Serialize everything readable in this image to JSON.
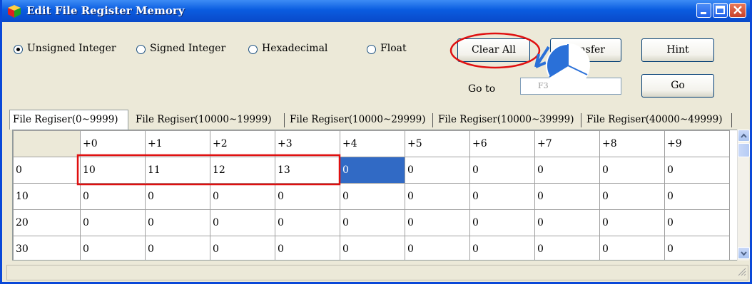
{
  "window": {
    "title": "Edit File Register Memory"
  },
  "format_options": [
    {
      "label": "Unsigned Integer",
      "selected": true
    },
    {
      "label": "Signed Integer",
      "selected": false
    },
    {
      "label": "Hexadecimal",
      "selected": false
    },
    {
      "label": "Float",
      "selected": false
    }
  ],
  "buttons": {
    "clear_all": "Clear All",
    "transfer": "nsfer",
    "hint": "Hint",
    "go": "Go"
  },
  "goto": {
    "label": "Go to",
    "value": "F3"
  },
  "tabs": [
    "File Regiser(0~9999)",
    "File Regiser(10000~19999)",
    "File Regiser(10000~29999)",
    "File Regiser(10000~39999)",
    "File Regiser(40000~49999)"
  ],
  "grid": {
    "columns": [
      "+0",
      "+1",
      "+2",
      "+3",
      "+4",
      "+5",
      "+6",
      "+7",
      "+8",
      "+9"
    ],
    "rows": [
      {
        "addr": "0",
        "values": [
          "10",
          "11",
          "12",
          "13",
          "0",
          "0",
          "0",
          "0",
          "0",
          "0"
        ]
      },
      {
        "addr": "10",
        "values": [
          "0",
          "0",
          "0",
          "0",
          "0",
          "0",
          "0",
          "0",
          "0",
          "0"
        ]
      },
      {
        "addr": "20",
        "values": [
          "0",
          "0",
          "0",
          "0",
          "0",
          "0",
          "0",
          "0",
          "0",
          "0"
        ]
      },
      {
        "addr": "30",
        "values": [
          "0",
          "0",
          "0",
          "0",
          "0",
          "0",
          "0",
          "0",
          "0",
          "0"
        ]
      }
    ],
    "selected_cell": {
      "row": 0,
      "col": 4
    }
  },
  "colors": {
    "highlight_red": "#e01010",
    "selection_blue": "#316ac5",
    "pointer_blue": "#2a70d8"
  },
  "icons": [
    "app-cube-icon",
    "minimize-icon",
    "maximize-icon",
    "close-icon",
    "scroll-up-icon",
    "scroll-down-icon",
    "resize-grip-icon",
    "pie-pointer-icon"
  ]
}
